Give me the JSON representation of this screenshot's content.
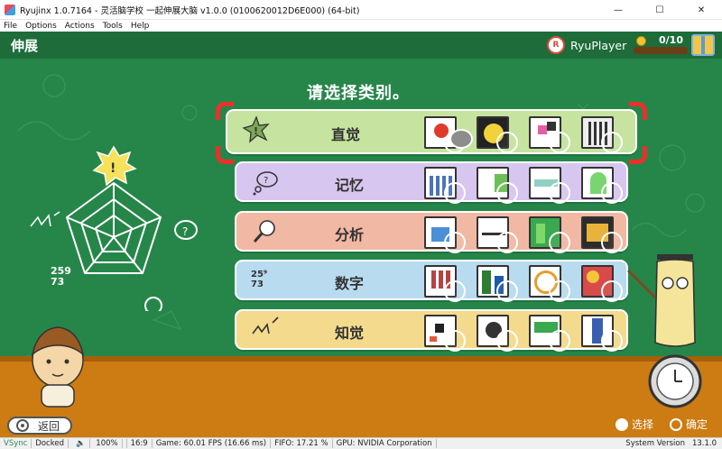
{
  "window": {
    "title": "Ryujinx 1.0.7164 - 灵活脑学校 一起伸展大脑 v1.0.0 (0100620012D6E000) (64-bit)",
    "minimize": "—",
    "maximize": "☐",
    "close": "✕"
  },
  "menu": [
    "File",
    "Options",
    "Actions",
    "Tools",
    "Help"
  ],
  "game": {
    "title": "伸展",
    "player_name": "RyuPlayer",
    "coin_count": "0/10",
    "heading": "请选择类别。",
    "categories": [
      {
        "label": "直觉",
        "selected": true
      },
      {
        "label": "记忆",
        "selected": false
      },
      {
        "label": "分析",
        "selected": false
      },
      {
        "label": "数字",
        "selected": false
      },
      {
        "label": "知觉",
        "selected": false
      }
    ],
    "chalk_number": "259 73",
    "back_label": "返回",
    "hint_select": "选择",
    "hint_confirm": "确定"
  },
  "status": {
    "vsync": "VSync",
    "dock": "Docked",
    "volume": "100%",
    "aspect": "16:9",
    "game_fps": "Game: 60.01 FPS (16.66 ms)",
    "fifo": "FIFO: 17.21 %",
    "gpu": "GPU: NVIDIA Corporation",
    "system_version_label": "System Version",
    "system_version": "13.1.0"
  },
  "colors": {
    "board": "#26864a",
    "floor": "#cc7c12",
    "select_bracket": "#e8312b",
    "row_intuition": "#c6e3a0",
    "row_memory": "#d7c6ef",
    "row_analysis": "#f1b8a3",
    "row_numbers": "#b9dbef",
    "row_perception": "#f3da8d"
  }
}
